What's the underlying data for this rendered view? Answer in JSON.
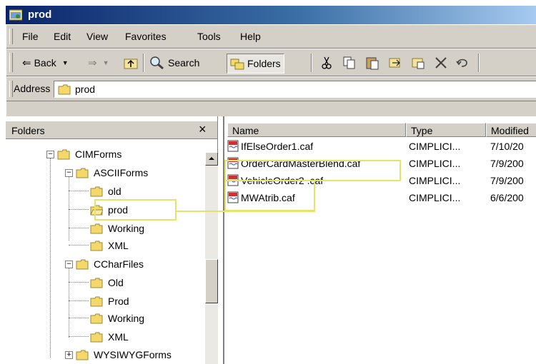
{
  "window": {
    "title": "prod"
  },
  "menu": {
    "items": [
      "File",
      "Edit",
      "View",
      "Favorites",
      "Tools",
      "Help"
    ]
  },
  "toolbar": {
    "back_label": "Back",
    "search_label": "Search",
    "folders_label": "Folders"
  },
  "address": {
    "label": "Address",
    "value": "prod"
  },
  "folders_pane": {
    "title": "Folders",
    "close_glyph": "×",
    "tree": [
      {
        "label": "CIMForms",
        "expander": "−"
      },
      {
        "label": "ASCIIForms",
        "expander": "−"
      },
      {
        "label": "old"
      },
      {
        "label": "prod"
      },
      {
        "label": "Working"
      },
      {
        "label": "XML"
      },
      {
        "label": "CCharFiles",
        "expander": "−"
      },
      {
        "label": "Old"
      },
      {
        "label": "Prod"
      },
      {
        "label": "Working"
      },
      {
        "label": "XML"
      },
      {
        "label": "WYSIWYGForms",
        "expander": "+"
      }
    ]
  },
  "file_list": {
    "columns": [
      "Name",
      "Type",
      "Modified"
    ],
    "rows": [
      {
        "name": "IfElseOrder1.caf",
        "type": "CIMPLICI...",
        "modified": "7/10/20"
      },
      {
        "name": "OrderCardMasterBlend.caf",
        "type": "CIMPLICI...",
        "modified": "7/9/200"
      },
      {
        "name": "VehicleOrder2 .caf",
        "type": "CIMPLICI...",
        "modified": "7/9/200"
      },
      {
        "name": "MWAtrib.caf",
        "type": "CIMPLICI...",
        "modified": "6/6/200"
      }
    ]
  },
  "colors": {
    "callout": "#e6e36a",
    "title_bar": "#0a246a",
    "chrome": "#d4d0c8"
  }
}
